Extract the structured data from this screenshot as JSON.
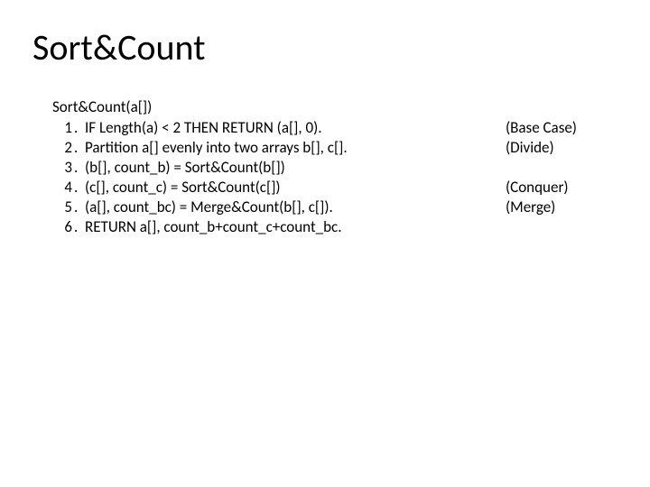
{
  "title": "Sort&Count",
  "func_header": "Sort&Count(a[])",
  "lines": [
    {
      "n": "1",
      "text": "IF Length(a) < 2 THEN RETURN (a[], 0).",
      "annot": "(Base Case)"
    },
    {
      "n": "2",
      "text": "Partition a[] evenly into two arrays b[], c[].",
      "annot": " (Divide)"
    },
    {
      "n": "3",
      "text": "(b[], count_b) = Sort&Count(b[])",
      "annot": ""
    },
    {
      "n": "4",
      "text": "(c[], count_c) = Sort&Count(c[])",
      "annot": " (Conquer)"
    },
    {
      "n": "5",
      "text": "(a[], count_bc) = Merge&Count(b[], c[]).",
      "annot": "  (Merge)"
    },
    {
      "n": "6",
      "text": "RETURN a[], count_b+count_c+count_bc.",
      "annot": ""
    }
  ]
}
